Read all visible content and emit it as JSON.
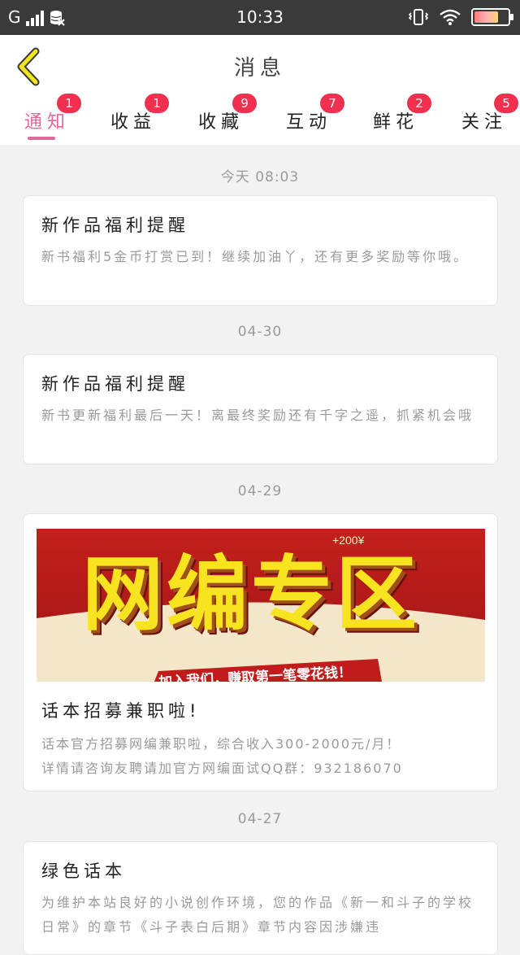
{
  "status_bar": {
    "carrier": "G",
    "time": "10:33"
  },
  "header": {
    "title": "消息",
    "back_icon": "chevron-left-icon"
  },
  "tabs": [
    {
      "label": "通知",
      "badge": "1",
      "active": true
    },
    {
      "label": "收益",
      "badge": "1",
      "active": false
    },
    {
      "label": "收藏",
      "badge": "9",
      "active": false
    },
    {
      "label": "互动",
      "badge": "7",
      "active": false
    },
    {
      "label": "鲜花",
      "badge": "2",
      "active": false
    },
    {
      "label": "关注",
      "badge": "5",
      "active": false
    }
  ],
  "messages": [
    {
      "date": "今天 08:03",
      "title": "新作品福利提醒",
      "body": "新书福利5金币打赏已到！继续加油丫，还有更多奖励等你哦。"
    },
    {
      "date": "04-30",
      "title": "新作品福利提醒",
      "body": "新书更新福利最后一天！离最终奖励还有千字之遥，抓紧机会哦"
    },
    {
      "date": "04-29",
      "banner": {
        "headline": "网编专区",
        "amount": "+200¥",
        "slogan": "加入我们，赚取第一笔零花钱！"
      },
      "title": "话本招募兼职啦!",
      "body_line1": "话本官方招募网编兼职啦，综合收入300-2000元/月！",
      "body_line2": "详情请咨询友聘请加官方网编面试QQ群：932186070"
    },
    {
      "date": "04-27",
      "title": "绿色话本",
      "body": "为维护本站良好的小说创作环境，您的作品《新一和斗子的学校日常》的章节《斗子表白后期》章节内容因涉嫌违"
    }
  ],
  "colors": {
    "accent": "#e2679a",
    "badge": "#f0304e",
    "back_icon": "#f2e51c"
  }
}
